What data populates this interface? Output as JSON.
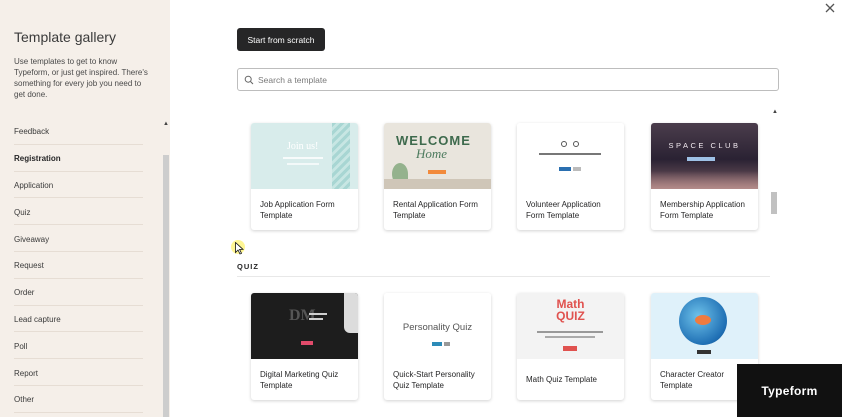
{
  "sidebar": {
    "title": "Template gallery",
    "description": "Use templates to get to know Typeform, or just get inspired. There's something for every job you need to get done.",
    "categories": [
      {
        "label": "Feedback",
        "active": false
      },
      {
        "label": "Registration",
        "active": true
      },
      {
        "label": "Application",
        "active": false
      },
      {
        "label": "Quiz",
        "active": false
      },
      {
        "label": "Giveaway",
        "active": false
      },
      {
        "label": "Request",
        "active": false
      },
      {
        "label": "Order",
        "active": false
      },
      {
        "label": "Lead capture",
        "active": false
      },
      {
        "label": "Poll",
        "active": false
      },
      {
        "label": "Report",
        "active": false
      },
      {
        "label": "Other",
        "active": false
      }
    ]
  },
  "toolbar": {
    "scratch_label": "Start from scratch"
  },
  "search": {
    "placeholder": "Search a template"
  },
  "sections": [
    {
      "label": "",
      "templates": [
        {
          "title": "Job Application Form Template",
          "thumb_text": "Join us!",
          "thumb_text_2": ""
        },
        {
          "title": "Rental Application Form Template",
          "thumb_text": "WELCOME",
          "thumb_text_2": "Home"
        },
        {
          "title": "Volunteer Application Form Template",
          "thumb_text": "",
          "thumb_text_2": ""
        },
        {
          "title": "Membership Application Form Template",
          "thumb_text": "SPACE CLUB",
          "thumb_text_2": ""
        }
      ]
    },
    {
      "label": "QUIZ",
      "templates": [
        {
          "title": "Digital Marketing Quiz Template",
          "thumb_text": "",
          "thumb_text_2": ""
        },
        {
          "title": "Quick-Start Personality Quiz Template",
          "thumb_text": "Personality Quiz",
          "thumb_text_2": ""
        },
        {
          "title": "Math Quiz Template",
          "thumb_text": "Math",
          "thumb_text_2": "QUIZ"
        },
        {
          "title": "Character Creator Template",
          "thumb_text": "",
          "thumb_text_2": ""
        }
      ]
    }
  ],
  "watermark": {
    "text": "Typeform"
  },
  "icons": {
    "close": "close-icon",
    "search": "search-icon",
    "cursor": "cursor-icon"
  },
  "colors": {
    "sidebar_bg": "#f5efe9",
    "primary_button": "#262627",
    "text": "#262627"
  }
}
